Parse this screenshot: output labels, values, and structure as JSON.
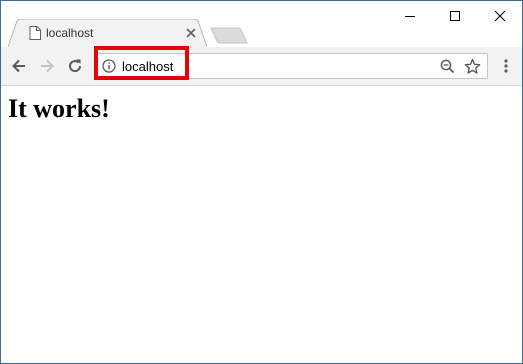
{
  "tab": {
    "title": "localhost"
  },
  "omnibox": {
    "url": "localhost"
  },
  "page": {
    "heading": "It works!"
  },
  "colors": {
    "highlight": "#e8000b",
    "toolbar_bg": "#f2f2f2",
    "window_border": "#3e6a96"
  },
  "icons": {
    "tab_favicon": "page-icon",
    "tab_close": "close-icon",
    "back": "arrow-left-icon",
    "forward": "arrow-right-icon",
    "reload": "reload-icon",
    "site_info": "info-icon",
    "zoom": "zoom-out-icon",
    "bookmark": "star-icon",
    "menu": "vertical-dots-icon",
    "minimize": "minimize-icon",
    "maximize": "maximize-icon",
    "close_window": "close-icon"
  }
}
